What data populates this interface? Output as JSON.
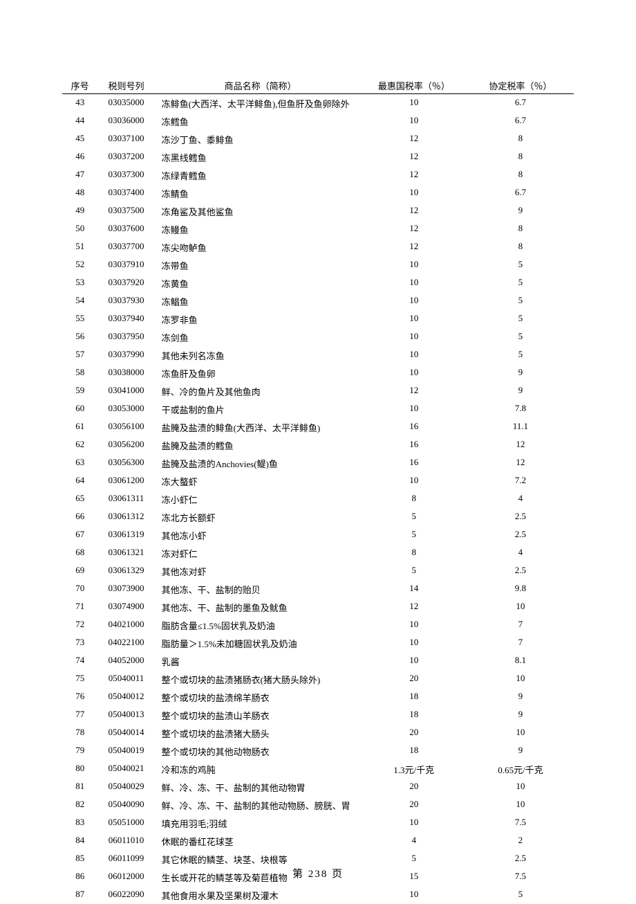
{
  "headers": {
    "seq": "序号",
    "code": "税则号列",
    "name": "商品名称（简称）",
    "mfn": "最惠国税率（％）",
    "agr": "协定税率（％）"
  },
  "rows": [
    {
      "seq": "43",
      "code": "03035000",
      "name": "冻鲱鱼(大西洋、太平洋鲱鱼),但鱼肝及鱼卵除外",
      "mfn": "10",
      "agr": "6.7"
    },
    {
      "seq": "44",
      "code": "03036000",
      "name": "冻鳕鱼",
      "mfn": "10",
      "agr": "6.7"
    },
    {
      "seq": "45",
      "code": "03037100",
      "name": "冻沙丁鱼、黍鲱鱼",
      "mfn": "12",
      "agr": "8"
    },
    {
      "seq": "46",
      "code": "03037200",
      "name": "冻黑线鳕鱼",
      "mfn": "12",
      "agr": "8"
    },
    {
      "seq": "47",
      "code": "03037300",
      "name": "冻绿青鳕鱼",
      "mfn": "12",
      "agr": "8"
    },
    {
      "seq": "48",
      "code": "03037400",
      "name": "冻鲭鱼",
      "mfn": "10",
      "agr": "6.7"
    },
    {
      "seq": "49",
      "code": "03037500",
      "name": "冻角鲨及其他鲨鱼",
      "mfn": "12",
      "agr": "9"
    },
    {
      "seq": "50",
      "code": "03037600",
      "name": "冻鳗鱼",
      "mfn": "12",
      "agr": "8"
    },
    {
      "seq": "51",
      "code": "03037700",
      "name": "冻尖吻鲈鱼",
      "mfn": "12",
      "agr": "8"
    },
    {
      "seq": "52",
      "code": "03037910",
      "name": "冻带鱼",
      "mfn": "10",
      "agr": "5"
    },
    {
      "seq": "53",
      "code": "03037920",
      "name": "冻黄鱼",
      "mfn": "10",
      "agr": "5"
    },
    {
      "seq": "54",
      "code": "03037930",
      "name": "冻鲳鱼",
      "mfn": "10",
      "agr": "5"
    },
    {
      "seq": "55",
      "code": "03037940",
      "name": "冻罗非鱼",
      "mfn": "10",
      "agr": "5"
    },
    {
      "seq": "56",
      "code": "03037950",
      "name": "冻剑鱼",
      "mfn": "10",
      "agr": "5"
    },
    {
      "seq": "57",
      "code": "03037990",
      "name": "其他未列名冻鱼",
      "mfn": "10",
      "agr": "5"
    },
    {
      "seq": "58",
      "code": "03038000",
      "name": "冻鱼肝及鱼卵",
      "mfn": "10",
      "agr": "9"
    },
    {
      "seq": "59",
      "code": "03041000",
      "name": "鲜、冷的鱼片及其他鱼肉",
      "mfn": "12",
      "agr": "9"
    },
    {
      "seq": "60",
      "code": "03053000",
      "name": "干或盐制的鱼片",
      "mfn": "10",
      "agr": "7.8"
    },
    {
      "seq": "61",
      "code": "03056100",
      "name": "盐腌及盐渍的鲱鱼(大西洋、太平洋鲱鱼)",
      "mfn": "16",
      "agr": "11.1"
    },
    {
      "seq": "62",
      "code": "03056200",
      "name": "盐腌及盐渍的鳕鱼",
      "mfn": "16",
      "agr": "12"
    },
    {
      "seq": "63",
      "code": "03056300",
      "name": "盐腌及盐渍的Anchovies(鳀)鱼",
      "mfn": "16",
      "agr": "12"
    },
    {
      "seq": "64",
      "code": "03061200",
      "name": "冻大螯虾",
      "mfn": "10",
      "agr": "7.2"
    },
    {
      "seq": "65",
      "code": "03061311",
      "name": "冻小虾仁",
      "mfn": "8",
      "agr": "4"
    },
    {
      "seq": "66",
      "code": "03061312",
      "name": "冻北方长额虾",
      "mfn": "5",
      "agr": "2.5"
    },
    {
      "seq": "67",
      "code": "03061319",
      "name": "其他冻小虾",
      "mfn": "5",
      "agr": "2.5"
    },
    {
      "seq": "68",
      "code": "03061321",
      "name": "冻对虾仁",
      "mfn": "8",
      "agr": "4"
    },
    {
      "seq": "69",
      "code": "03061329",
      "name": "其他冻对虾",
      "mfn": "5",
      "agr": "2.5"
    },
    {
      "seq": "70",
      "code": "03073900",
      "name": "其他冻、干、盐制的贻贝",
      "mfn": "14",
      "agr": "9.8"
    },
    {
      "seq": "71",
      "code": "03074900",
      "name": "其他冻、干、盐制的墨鱼及鱿鱼",
      "mfn": "12",
      "agr": "10"
    },
    {
      "seq": "72",
      "code": "04021000",
      "name": "脂肪含量≤1.5%固状乳及奶油",
      "mfn": "10",
      "agr": "7"
    },
    {
      "seq": "73",
      "code": "04022100",
      "name": "脂肪量＞1.5%未加糖固状乳及奶油",
      "mfn": "10",
      "agr": "7"
    },
    {
      "seq": "74",
      "code": "04052000",
      "name": "乳酱",
      "mfn": "10",
      "agr": "8.1"
    },
    {
      "seq": "75",
      "code": "05040011",
      "name": "整个或切块的盐渍猪肠衣(猪大肠头除外)",
      "mfn": "20",
      "agr": "10"
    },
    {
      "seq": "76",
      "code": "05040012",
      "name": "整个或切块的盐渍绵羊肠衣",
      "mfn": "18",
      "agr": "9"
    },
    {
      "seq": "77",
      "code": "05040013",
      "name": "整个或切块的盐渍山羊肠衣",
      "mfn": "18",
      "agr": "9"
    },
    {
      "seq": "78",
      "code": "05040014",
      "name": "整个或切块的盐渍猪大肠头",
      "mfn": "20",
      "agr": "10"
    },
    {
      "seq": "79",
      "code": "05040019",
      "name": "整个或切块的其他动物肠衣",
      "mfn": "18",
      "agr": "9"
    },
    {
      "seq": "80",
      "code": "05040021",
      "name": "冷和冻的鸡肫",
      "mfn": "1.3元/千克",
      "agr": "0.65元/千克"
    },
    {
      "seq": "81",
      "code": "05040029",
      "name": "鲜、冷、冻、干、盐制的其他动物胃",
      "mfn": "20",
      "agr": "10"
    },
    {
      "seq": "82",
      "code": "05040090",
      "name": "鲜、冷、冻、干、盐制的其他动物肠、膀胱、胃",
      "mfn": "20",
      "agr": "10"
    },
    {
      "seq": "83",
      "code": "05051000",
      "name": "填充用羽毛;羽绒",
      "mfn": "10",
      "agr": "7.5"
    },
    {
      "seq": "84",
      "code": "06011010",
      "name": "休眠的番红花球茎",
      "mfn": "4",
      "agr": "2"
    },
    {
      "seq": "85",
      "code": "06011099",
      "name": "其它休眠的鳞茎、块茎、块根等",
      "mfn": "5",
      "agr": "2.5"
    },
    {
      "seq": "86",
      "code": "06012000",
      "name": "生长或开花的鳞茎等及菊苣植物",
      "mfn": "15",
      "agr": "7.5"
    },
    {
      "seq": "87",
      "code": "06022090",
      "name": "其他食用水果及坚果树及灌木",
      "mfn": "10",
      "agr": "5"
    }
  ],
  "page_number": "第 238 页"
}
